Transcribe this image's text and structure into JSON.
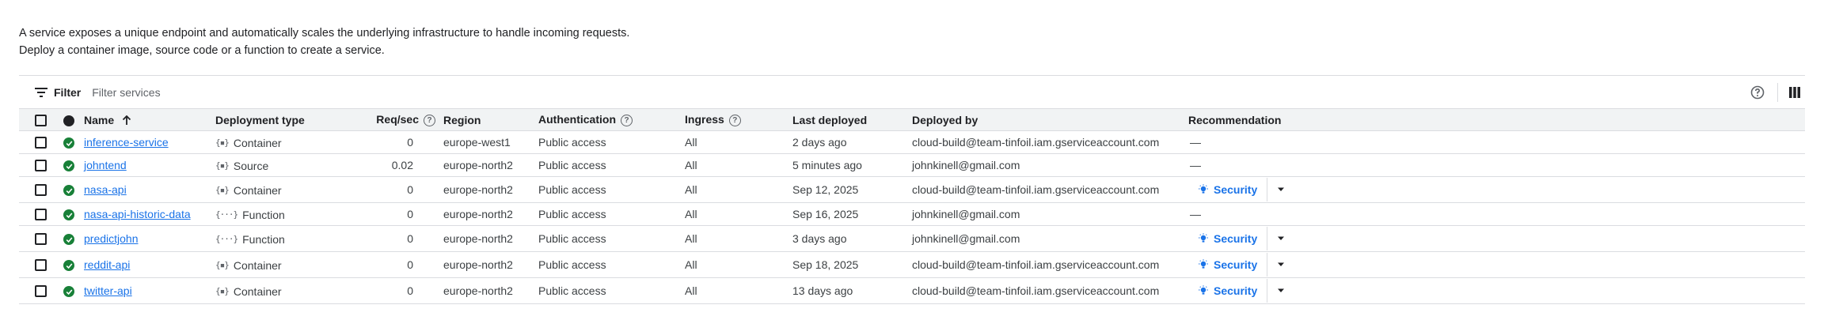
{
  "intro": {
    "line1": "A service exposes a unique endpoint and automatically scales the underlying infrastructure to handle incoming requests.",
    "line2": "Deploy a container image, source code or a function to create a service."
  },
  "filter": {
    "label": "Filter",
    "placeholder": "Filter services"
  },
  "columns": {
    "name": "Name",
    "deployment_type": "Deployment type",
    "req_sec": "Req/sec",
    "region": "Region",
    "authentication": "Authentication",
    "ingress": "Ingress",
    "last_deployed": "Last deployed",
    "deployed_by": "Deployed by",
    "recommendation": "Recommendation"
  },
  "rows": [
    {
      "name": "inference-service",
      "type": "Container",
      "type_icon": "container-icon",
      "req": "0",
      "region": "europe-west1",
      "auth": "Public access",
      "ingress": "All",
      "last": "2 days ago",
      "by": "cloud-build@team-tinfoil.iam.gserviceaccount.com",
      "rec": "—"
    },
    {
      "name": "johntend",
      "type": "Source",
      "type_icon": "source-icon",
      "req": "0.02",
      "region": "europe-north2",
      "auth": "Public access",
      "ingress": "All",
      "last": "5 minutes ago",
      "by": "johnkinell@gmail.com",
      "rec": "—"
    },
    {
      "name": "nasa-api",
      "type": "Container",
      "type_icon": "container-icon",
      "req": "0",
      "region": "europe-north2",
      "auth": "Public access",
      "ingress": "All",
      "last": "Sep 12, 2025",
      "by": "cloud-build@team-tinfoil.iam.gserviceaccount.com",
      "rec": "Security"
    },
    {
      "name": "nasa-api-historic-data",
      "type": "Function",
      "type_icon": "function-icon",
      "req": "0",
      "region": "europe-north2",
      "auth": "Public access",
      "ingress": "All",
      "last": "Sep 16, 2025",
      "by": "johnkinell@gmail.com",
      "rec": "—"
    },
    {
      "name": "predictjohn",
      "type": "Function",
      "type_icon": "function-icon",
      "req": "0",
      "region": "europe-north2",
      "auth": "Public access",
      "ingress": "All",
      "last": "3 days ago",
      "by": "johnkinell@gmail.com",
      "rec": "Security"
    },
    {
      "name": "reddit-api",
      "type": "Container",
      "type_icon": "container-icon",
      "req": "0",
      "region": "europe-north2",
      "auth": "Public access",
      "ingress": "All",
      "last": "Sep 18, 2025",
      "by": "cloud-build@team-tinfoil.iam.gserviceaccount.com",
      "rec": "Security"
    },
    {
      "name": "twitter-api",
      "type": "Container",
      "type_icon": "container-icon",
      "req": "0",
      "region": "europe-north2",
      "auth": "Public access",
      "ingress": "All",
      "last": "13 days ago",
      "by": "cloud-build@team-tinfoil.iam.gserviceaccount.com",
      "rec": "Security"
    }
  ],
  "colors": {
    "accent": "#1a73e8",
    "status_ok": "#188038",
    "header_bg": "#f1f3f4",
    "border": "#dadce0"
  }
}
